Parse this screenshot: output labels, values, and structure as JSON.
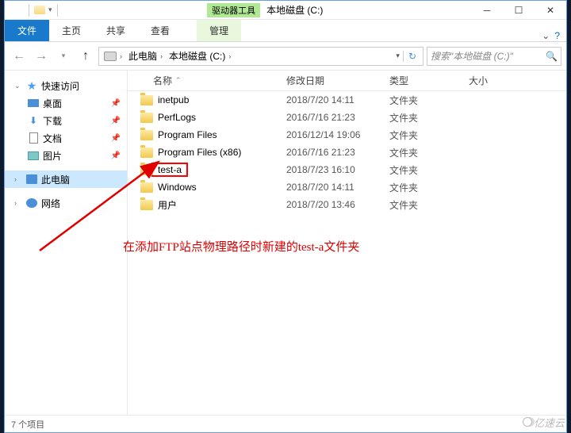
{
  "title": {
    "context_label": "驱动器工具",
    "window_title": "本地磁盘 (C:)"
  },
  "ribbon": {
    "file": "文件",
    "home": "主页",
    "share": "共享",
    "view": "查看",
    "manage": "管理"
  },
  "breadcrumb": {
    "root": "此电脑",
    "drive": "本地磁盘 (C:)"
  },
  "search": {
    "placeholder": "搜索\"本地磁盘 (C:)\""
  },
  "nav": {
    "quick": "快速访问",
    "desktop": "桌面",
    "downloads": "下载",
    "documents": "文档",
    "pictures": "图片",
    "thispc": "此电脑",
    "network": "网络"
  },
  "cols": {
    "name": "名称",
    "modified": "修改日期",
    "type": "类型",
    "size": "大小"
  },
  "rows": [
    {
      "name": "inetpub",
      "date": "2018/7/20 14:11",
      "type": "文件夹"
    },
    {
      "name": "PerfLogs",
      "date": "2016/7/16 21:23",
      "type": "文件夹"
    },
    {
      "name": "Program Files",
      "date": "2016/12/14 19:06",
      "type": "文件夹"
    },
    {
      "name": "Program Files (x86)",
      "date": "2016/7/16 21:23",
      "type": "文件夹"
    },
    {
      "name": "test-a",
      "date": "2018/7/23 16:10",
      "type": "文件夹",
      "hl": true
    },
    {
      "name": "Windows",
      "date": "2018/7/20 14:11",
      "type": "文件夹"
    },
    {
      "name": "用户",
      "date": "2018/7/20 13:46",
      "type": "文件夹"
    }
  ],
  "status": {
    "count": "7 个项目"
  },
  "annotation": "在添加FTP站点物理路径时新建的test-a文件夹",
  "watermark": "亿速云"
}
